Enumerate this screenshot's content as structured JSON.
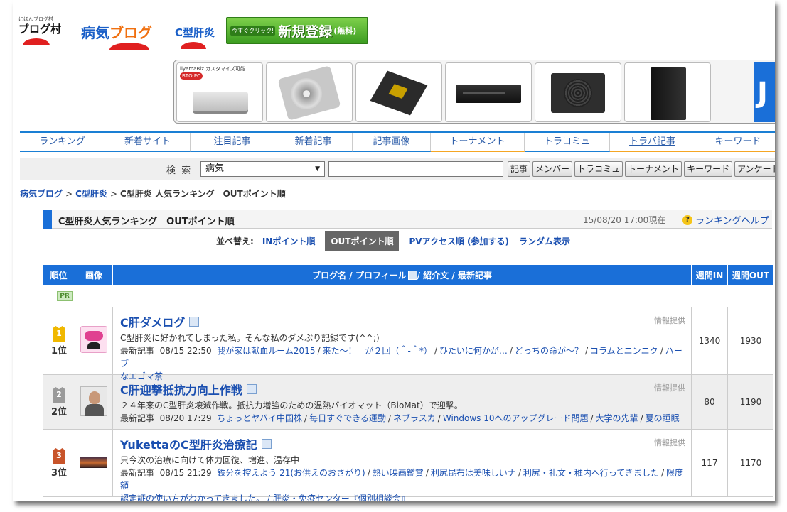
{
  "logos": {
    "mura_small": "にほんブログ村",
    "mura": "ブログ村",
    "byoki_main": "病気",
    "byoki_blog": "ブログ",
    "c_liver": "C型肝炎",
    "register_small": "今すぐクリック!",
    "register_main": "新規登録",
    "register_free": "(無料)"
  },
  "banner": {
    "caption": "iiyamaBiz カスタマイズ可能",
    "bto": "BTO PC",
    "products": [
      "mini-pc",
      "hard-disk",
      "motherboard",
      "optical-drive",
      "power-supply",
      "pc-case"
    ]
  },
  "nav": {
    "tabs": [
      {
        "label": "ランキング"
      },
      {
        "label": "新着サイト"
      },
      {
        "label": "注目記事"
      },
      {
        "label": "新着記事"
      },
      {
        "label": "記事画像"
      },
      {
        "label": "トーナメント"
      },
      {
        "label": "トラコミュ"
      },
      {
        "label": "トラバ記事"
      },
      {
        "label": "キーワード"
      }
    ]
  },
  "search": {
    "label": "検 索",
    "category": "病気",
    "input_value": "",
    "buttons": [
      "記事",
      "メンバー",
      "トラコミュ",
      "トーナメント",
      "キーワード",
      "アンケート"
    ]
  },
  "breadcrumb": {
    "item1": "病気ブログ",
    "item2": "C型肝炎",
    "current": "C型肝炎 人気ランキング　OUTポイント順"
  },
  "ranking": {
    "title": "C型肝炎人気ランキング　OUTポイント順",
    "date": "15/08/20 17:00現在",
    "help": "ランキングヘルプ"
  },
  "sort": {
    "label": "並べ替え:",
    "in_points": "INポイント順",
    "out_points": "OUTポイント順",
    "pv": "PVアクセス順",
    "join": "(参加する)",
    "random": "ランダム表示"
  },
  "table": {
    "headers": {
      "rank": "順位",
      "image": "画像",
      "blog": "ブログ名 / プロフィール",
      "blog_tail": " / 紹介文 / 最新記事",
      "week_in": "週間IN",
      "week_out": "週間OUT"
    },
    "pr": "PR",
    "info_label": "情報提供",
    "latest_label": "最新記事",
    "rows": [
      {
        "rank_num": "1",
        "rank_label": "1位",
        "medal_color": "#f0b800",
        "title": "C肝ダメログ",
        "desc": "C型肝炎に好かれてしまった私。そんな私のダメぶり記録です(^^;)",
        "date": "08/15 22:50",
        "articles_line1": [
          "我が家は献血ルーム2015",
          "来た～！　が２回（＾-＾*）",
          "ひたいに何かが…",
          "どっちの命が～？",
          "コラムとニンニク",
          "ハーブ"
        ],
        "articles_line2": "なエゴマ茶",
        "week_in": "1340",
        "week_out": "1930"
      },
      {
        "rank_num": "2",
        "rank_label": "2位",
        "medal_color": "#9a9a9a",
        "title": "C肝迎撃抵抗力向上作戦",
        "desc": "２４年来のC型肝炎壊滅作戦。抵抗力増強のための温熱バイオマット（BioMat）で迎撃。",
        "date": "08/20 17:29",
        "articles_line1": [
          "ちょっとヤバイ中国株",
          "毎日すぐできる運動",
          "ネブラスカ",
          "Windows 10へのアップグレード問題",
          "大学の先輩",
          "夏の睡眠"
        ],
        "articles_line2": "",
        "week_in": "80",
        "week_out": "1190"
      },
      {
        "rank_num": "3",
        "rank_label": "3位",
        "medal_color": "#c8542a",
        "title": "YukettaのC型肝炎治療記",
        "desc": "只今次の治療に向けて体力回復、増進、温存中",
        "date": "08/15 21:29",
        "articles_line1": [
          "鉄分を控えよう 21(お供えのおさがり)",
          "熱い映画鑑賞",
          "利尻昆布は美味しいナ",
          "利尻・礼文・稚内へ行ってきました",
          "限度額"
        ],
        "articles_line2": "認定証の使い方がわかってきました。 / 肝炎・免疫センター『個別相談会』",
        "week_in": "117",
        "week_out": "1170"
      }
    ]
  },
  "colors": {
    "accent_blue": "#1a6fd8",
    "link": "#1a4fb0",
    "tab_orange": "#f5a623"
  }
}
